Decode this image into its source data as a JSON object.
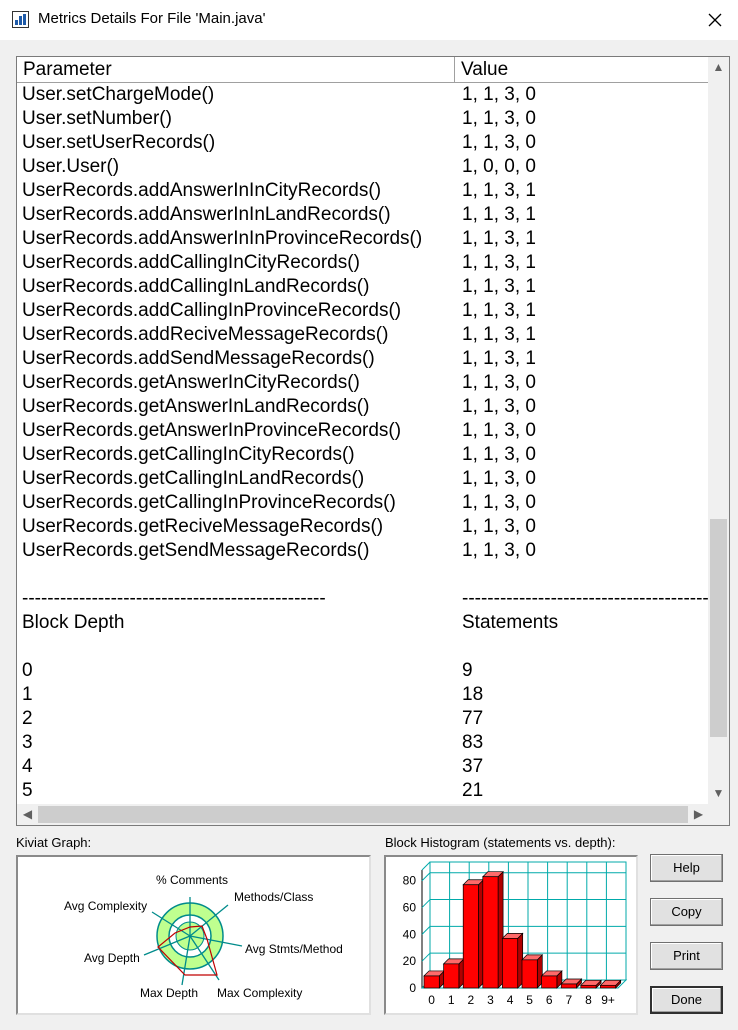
{
  "window": {
    "title": "Metrics Details For File 'Main.java'"
  },
  "table": {
    "columns": [
      "Parameter",
      "Value"
    ],
    "rows": [
      [
        "User.setChargeMode()",
        "1, 1, 3, 0"
      ],
      [
        "User.setNumber()",
        "1, 1, 3, 0"
      ],
      [
        "User.setUserRecords()",
        "1, 1, 3, 0"
      ],
      [
        "User.User()",
        "1, 0, 0, 0"
      ],
      [
        "UserRecords.addAnswerInInCityRecords()",
        "1, 1, 3, 1"
      ],
      [
        "UserRecords.addAnswerInInLandRecords()",
        "1, 1, 3, 1"
      ],
      [
        "UserRecords.addAnswerInInProvinceRecords()",
        "1, 1, 3, 1"
      ],
      [
        "UserRecords.addCallingInCityRecords()",
        "1, 1, 3, 1"
      ],
      [
        "UserRecords.addCallingInLandRecords()",
        "1, 1, 3, 1"
      ],
      [
        "UserRecords.addCallingInProvinceRecords()",
        "1, 1, 3, 1"
      ],
      [
        "UserRecords.addReciveMessageRecords()",
        "1, 1, 3, 1"
      ],
      [
        "UserRecords.addSendMessageRecords()",
        "1, 1, 3, 1"
      ],
      [
        "UserRecords.getAnswerInCityRecords()",
        "1, 1, 3, 0"
      ],
      [
        "UserRecords.getAnswerInLandRecords()",
        "1, 1, 3, 0"
      ],
      [
        "UserRecords.getAnswerInProvinceRecords()",
        "1, 1, 3, 0"
      ],
      [
        "UserRecords.getCallingInCityRecords()",
        "1, 1, 3, 0"
      ],
      [
        "UserRecords.getCallingInLandRecords()",
        "1, 1, 3, 0"
      ],
      [
        "UserRecords.getCallingInProvinceRecords()",
        "1, 1, 3, 0"
      ],
      [
        "UserRecords.getReciveMessageRecords()",
        "1, 1, 3, 0"
      ],
      [
        "UserRecords.getSendMessageRecords()",
        "1, 1, 3, 0"
      ],
      [
        "",
        ""
      ],
      [
        "------------------------------------------------",
        "------------------------------------------------"
      ],
      [
        "Block Depth",
        "Statements"
      ],
      [
        "",
        ""
      ],
      [
        "0",
        "9"
      ],
      [
        "1",
        "18"
      ],
      [
        "2",
        "77"
      ],
      [
        "3",
        "83"
      ],
      [
        "4",
        "37"
      ],
      [
        "5",
        "21"
      ]
    ]
  },
  "kiviat": {
    "label": "Kiviat Graph:",
    "axes": [
      "% Comments",
      "Methods/Class",
      "Avg Stmts/Method",
      "Max Complexity",
      "Max Depth",
      "Avg Depth",
      "Avg Complexity"
    ]
  },
  "histogram": {
    "label": "Block Histogram (statements vs. depth):"
  },
  "chart_data": {
    "type": "bar",
    "categories": [
      "0",
      "1",
      "2",
      "3",
      "4",
      "5",
      "6",
      "7",
      "8",
      "9+"
    ],
    "values": [
      9,
      18,
      77,
      83,
      37,
      21,
      9,
      3,
      2,
      2
    ],
    "yticks": [
      0,
      20,
      40,
      60,
      80
    ],
    "ylim": [
      0,
      88
    ],
    "grid": true,
    "bar_color": "#ff0000",
    "grid_color": "#00aaaa"
  },
  "buttons": {
    "help": "Help",
    "copy": "Copy",
    "print": "Print",
    "done": "Done"
  },
  "colors": {
    "kiviat_green": "#bfff8f",
    "kiviat_axis": "#008b8b",
    "kiviat_line": "#c00000"
  }
}
